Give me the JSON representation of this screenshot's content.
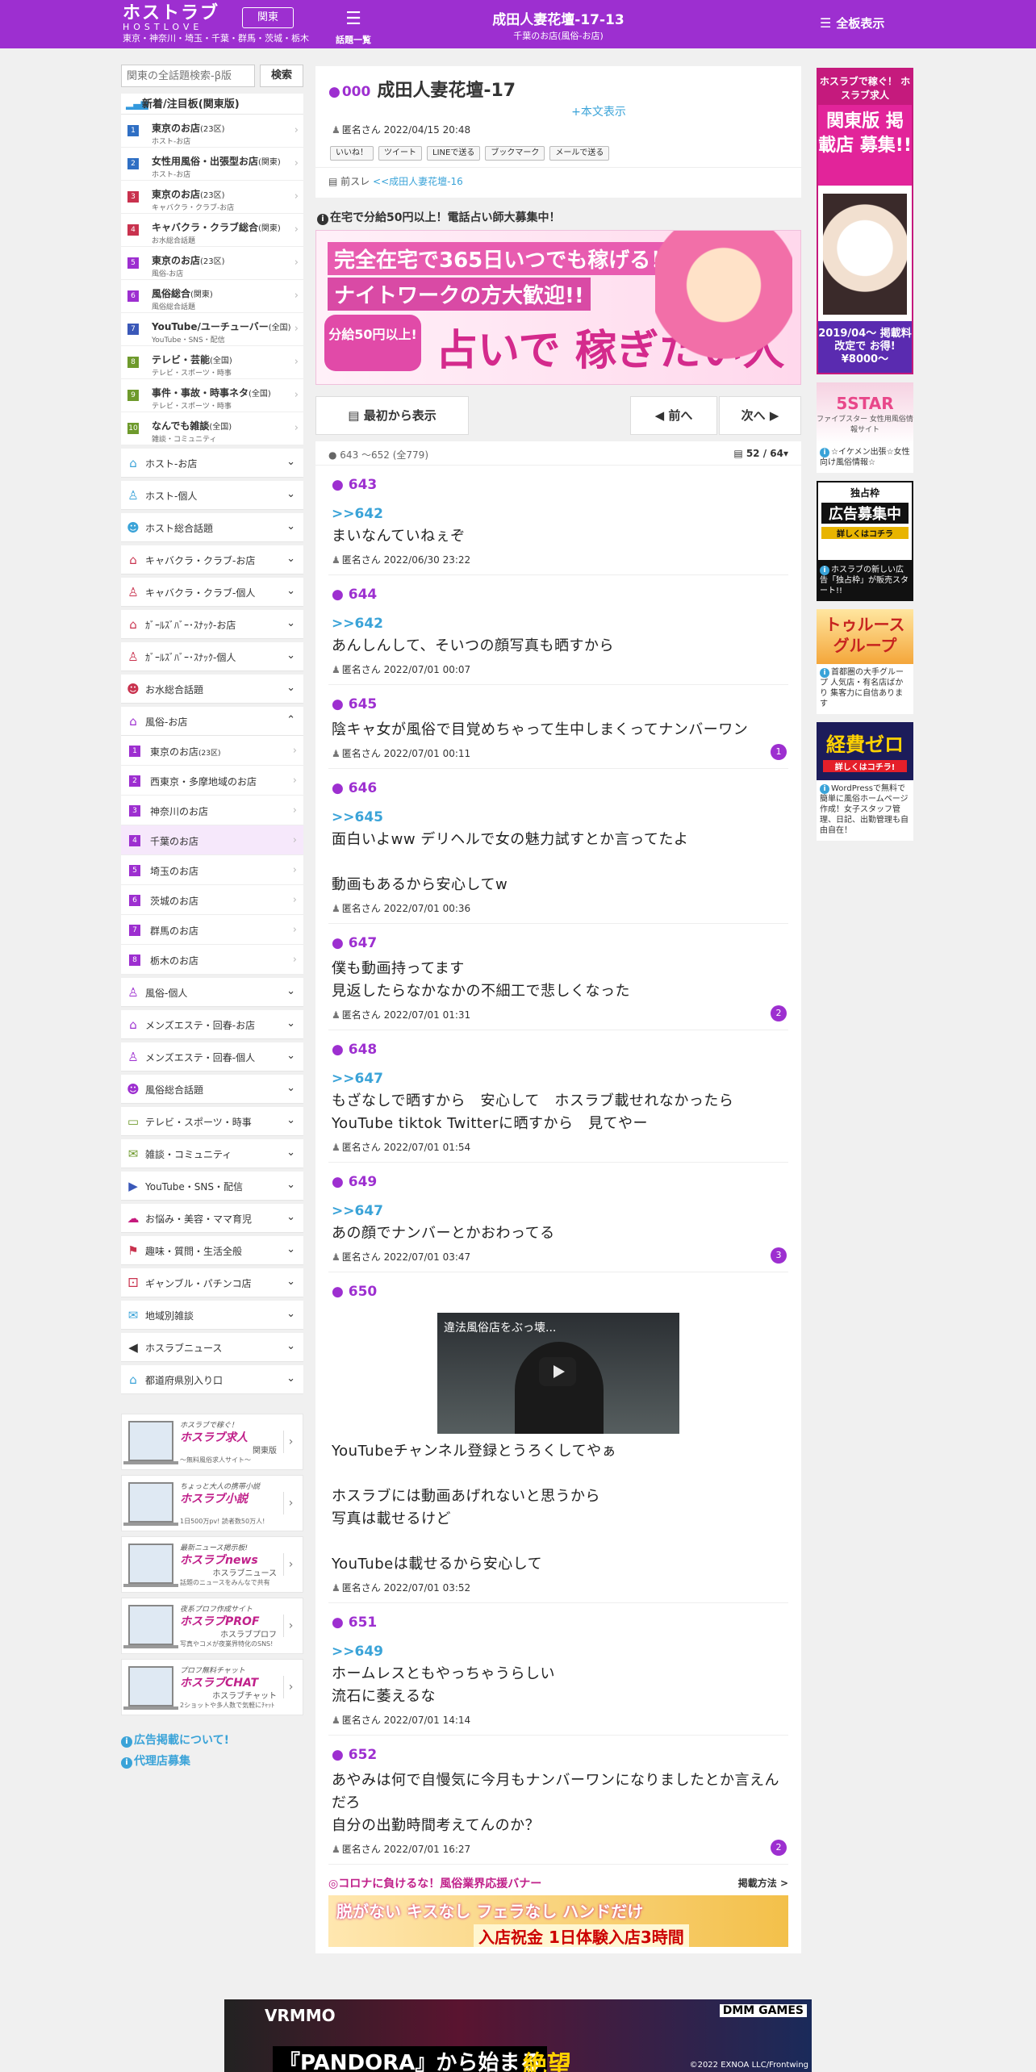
{
  "header": {
    "logo": "ホストラブ",
    "logo_en": "HOSTLOVE",
    "areas": "東京・神奈川・埼玉・千葉・群馬・茨城・栃木",
    "region_button": "関東",
    "topics_label": "話題一覧",
    "thread_title": "成田人妻花壇-17-13",
    "thread_sub": "千葉のお店(風俗-お店)",
    "all_display": "全板表示"
  },
  "search": {
    "placeholder": "関東の全話題検索-β版",
    "button": "検索"
  },
  "ranking": {
    "title": "新着/注目板(関東版)",
    "items": [
      {
        "n": "1",
        "color": "#2f6fc4",
        "title": "東京のお店",
        "tag": "(23区)",
        "sub": "ホスト-お店"
      },
      {
        "n": "2",
        "color": "#2f6fc4",
        "title": "女性用風俗・出張型お店",
        "tag": "(関東)",
        "sub": "ホスト-お店"
      },
      {
        "n": "3",
        "color": "#c9324e",
        "title": "東京のお店",
        "tag": "(23区)",
        "sub": "キャバクラ・クラブ-お店"
      },
      {
        "n": "4",
        "color": "#c9324e",
        "title": "キャバクラ・クラブ総合",
        "tag": "(関東)",
        "sub": "お水総合話題"
      },
      {
        "n": "5",
        "color": "#9d2fd0",
        "title": "東京のお店",
        "tag": "(23区)",
        "sub": "風俗-お店"
      },
      {
        "n": "6",
        "color": "#9d2fd0",
        "title": "風俗総合",
        "tag": "(関東)",
        "sub": "風俗総合話題"
      },
      {
        "n": "7",
        "color": "#3a58b8",
        "title": "YouTube/ユーチューバー",
        "tag": "(全国)",
        "sub": "YouTube・SNS・配信"
      },
      {
        "n": "8",
        "color": "#6e9a2c",
        "title": "テレビ・芸能",
        "tag": "(全国)",
        "sub": "テレビ・スポーツ・時事"
      },
      {
        "n": "9",
        "color": "#6e9a2c",
        "title": "事件・事故・時事ネタ",
        "tag": "(全国)",
        "sub": "テレビ・スポーツ・時事"
      },
      {
        "n": "10",
        "color": "#6e9a2c",
        "title": "なんでも雑談",
        "tag": "(全国)",
        "sub": "雑談・コミュニティ"
      }
    ]
  },
  "categories_a": [
    {
      "icon": "⌂",
      "color": "#3aa3d8",
      "label": "ホスト-お店"
    },
    {
      "icon": "♙",
      "color": "#3aa3d8",
      "label": "ホスト-個人"
    },
    {
      "icon": "☻",
      "color": "#3aa3d8",
      "label": "ホスト総合話題"
    },
    {
      "icon": "⌂",
      "color": "#c9324e",
      "label": "キャバクラ・クラブ-お店"
    },
    {
      "icon": "♙",
      "color": "#c9324e",
      "label": "キャバクラ・クラブ-個人"
    },
    {
      "icon": "⌂",
      "color": "#c9324e",
      "label": "ｶﾞｰﾙｽﾞﾊﾞｰ･ｽﾅｯｸ-お店"
    },
    {
      "icon": "♙",
      "color": "#c9324e",
      "label": "ｶﾞｰﾙｽﾞﾊﾞｰ･ｽﾅｯｸ-個人"
    },
    {
      "icon": "☻",
      "color": "#c9324e",
      "label": "お水総合話題"
    },
    {
      "icon": "⌂",
      "color": "#9d2fd0",
      "label": "風俗-お店"
    }
  ],
  "subs": [
    {
      "n": "1",
      "label": "東京のお店",
      "tag": "(23区)"
    },
    {
      "n": "2",
      "label": "西東京・多摩地域のお店",
      "tag": ""
    },
    {
      "n": "3",
      "label": "神奈川のお店",
      "tag": ""
    },
    {
      "n": "4",
      "label": "千葉のお店",
      "tag": ""
    },
    {
      "n": "5",
      "label": "埼玉のお店",
      "tag": ""
    },
    {
      "n": "6",
      "label": "茨城のお店",
      "tag": ""
    },
    {
      "n": "7",
      "label": "群馬のお店",
      "tag": ""
    },
    {
      "n": "8",
      "label": "栃木のお店",
      "tag": ""
    }
  ],
  "categories_b": [
    {
      "icon": "♙",
      "color": "#9d2fd0",
      "label": "風俗-個人"
    },
    {
      "icon": "⌂",
      "color": "#9d2fd0",
      "label": "メンズエステ・回春-お店"
    },
    {
      "icon": "♙",
      "color": "#9d2fd0",
      "label": "メンズエステ・回春-個人"
    },
    {
      "icon": "☻",
      "color": "#9d2fd0",
      "label": "風俗総合話題"
    },
    {
      "icon": "▭",
      "color": "#6e9a2c",
      "label": "テレビ・スポーツ・時事"
    },
    {
      "icon": "✉",
      "color": "#6e9a2c",
      "label": "雑談・コミュニティ"
    },
    {
      "icon": "▶",
      "color": "#3a58b8",
      "label": "YouTube・SNS・配信"
    },
    {
      "icon": "☁",
      "color": "#c51a7d",
      "label": "お悩み・美容・ママ育児"
    },
    {
      "icon": "⚑",
      "color": "#c9324e",
      "label": "趣味・質問・生活全般"
    },
    {
      "icon": "⚀",
      "color": "#c9324e",
      "label": "ギャンブル・パチンコ店"
    },
    {
      "icon": "✉",
      "color": "#3aa3d8",
      "label": "地域別雑談"
    },
    {
      "icon": "◀",
      "color": "#333333",
      "label": "ホスラブニュース"
    },
    {
      "icon": "⌂",
      "color": "#3aa3d8",
      "label": "都道府県別入り口"
    }
  ],
  "promos": [
    {
      "tag": "ホスラブで稼ぐ！",
      "name": "ホスラブ求人",
      "d1": "関東版",
      "d2": "〜無料風俗求人サイト〜"
    },
    {
      "tag": "ちょっと大人の携帯小説",
      "name": "ホスラブ小説",
      "d1": "",
      "d2": "1日500万pv! 読者数50万人!"
    },
    {
      "tag": "最新ニュース掲示板!",
      "name": "ホスラブnews",
      "d1": "ホスラブニュース",
      "d2": "話題のニュースをみんなで共有"
    },
    {
      "tag": "夜系プロフ作成サイト",
      "name": "ホスラブPROF",
      "d1": "ホスラブプロフ",
      "d2": "写真やコメが夜業界特化のSNS!"
    },
    {
      "tag": "プロフ無料チャット",
      "name": "ホスラブCHAT",
      "d1": "ホスラブチャット",
      "d2": "2ショットや多人数で気軽にﾁｬｯﾄ"
    }
  ],
  "left_links": {
    "ad": "広告掲載について!",
    "agency": "代理店募集"
  },
  "thread": {
    "no": "000",
    "title": "成田人妻花壇-17",
    "show_body": "+本文表示",
    "author": "匿名さん",
    "date": "2022/04/15 20:48",
    "shares": [
      "いいね！",
      "ツイート",
      "LINEで送る",
      "ブックマーク",
      "メールで送る"
    ],
    "prev_label": "前スレ",
    "prev_link": "<<成田人妻花壇-16"
  },
  "ad_heading": "在宅で分給50円以上！電話占い師大募集中！",
  "banner": {
    "line1": "完全在宅で365日いつでも稼げる！",
    "line2": "ナイトワークの方大歓迎!!",
    "pill": "分給50円以上!",
    "big": "占いで 稼ぎたい人 大募集！"
  },
  "nav": {
    "first": "最初から表示",
    "prev": "前へ",
    "next": "次へ"
  },
  "posts_header": {
    "range": "643 ～652 (全779)",
    "page": "52 / 64"
  },
  "posts": [
    {
      "no": "643",
      "anchor": ">>642",
      "text": "まいなんていねぇぞ",
      "author": "匿名さん",
      "date": "2022/06/30 23:22",
      "count": ""
    },
    {
      "no": "644",
      "anchor": ">>642",
      "text": "あんしんして、そいつの顔写真も晒すから",
      "author": "匿名さん",
      "date": "2022/07/01 00:07",
      "count": ""
    },
    {
      "no": "645",
      "anchor": "",
      "text": "陰キャ女が風俗で目覚めちゃって生中しまくってナンバーワン",
      "author": "匿名さん",
      "date": "2022/07/01 00:11",
      "count": "1"
    },
    {
      "no": "646",
      "anchor": ">>645",
      "text": "面白いよww デリヘルで女の魅力試すとか言ってたよ\n\n動画もあるから安心してw",
      "author": "匿名さん",
      "date": "2022/07/01 00:36",
      "count": ""
    },
    {
      "no": "647",
      "anchor": "",
      "text": "僕も動画持ってます\n見返したらなかなかの不細工で悲しくなった",
      "author": "匿名さん",
      "date": "2022/07/01 01:31",
      "count": "2"
    },
    {
      "no": "648",
      "anchor": ">>647",
      "text": "もざなしで晒すから　安心して　ホスラブ載せれなかったらYouTube tiktok Twitterに晒すから　見てやー",
      "author": "匿名さん",
      "date": "2022/07/01 01:54",
      "count": ""
    },
    {
      "no": "649",
      "anchor": ">>647",
      "text": "あの顔でナンバーとかおわってる",
      "author": "匿名さん",
      "date": "2022/07/01 03:47",
      "count": "3"
    },
    {
      "no": "650",
      "anchor": "",
      "video": "違法風俗店をぶっ壊...",
      "text": "YouTubeチャンネル登録とうろくしてやぁ\n\nホスラブには動画あげれないと思うから\n写真は載せるけど\n\nYouTubeは載せるから安心して",
      "author": "匿名さん",
      "date": "2022/07/01 03:52",
      "count": ""
    },
    {
      "no": "651",
      "anchor": ">>649",
      "text": "ホームレスともやっちゃうらしい\n流石に萎えるな",
      "author": "匿名さん",
      "date": "2022/07/01 14:14",
      "count": ""
    },
    {
      "no": "652",
      "anchor": "",
      "text": "あやみは何で自慢気に今月もナンバーワンになりましたとか言えんだろ\n自分の出勤時間考えてんのか？",
      "author": "匿名さん",
      "date": "2022/07/01 16:27",
      "count": "2"
    }
  ],
  "corona": {
    "title": "◎コロナに負けるな！風俗業界応援バナー",
    "how": "掲載方法 >",
    "ad1": "脱がない キスなし フェラなし ハンドだけ",
    "ad2": "入店祝金 1日体験入店3時間"
  },
  "right_ads": [
    {
      "id": "r1",
      "top": "ホスラブで稼ぐ！ ホスラブ求人",
      "mid": "関東版 掲載店 募集!!",
      "bot": "2019/04〜 掲載料改定で お得!¥8000〜",
      "cap": ""
    },
    {
      "id": "r2",
      "top": "5STAR",
      "mid": "ファイブスター 女性用風俗情報サイト",
      "bot": "",
      "cap": "☆イケメン出張☆女性向け風俗情報☆"
    },
    {
      "id": "r3",
      "top": "独占枠",
      "mid": "広告募集中",
      "bot": "詳しくはコチラ",
      "cap": "ホスラブの新しい広告「独占枠」が販売スタート!!"
    },
    {
      "id": "r4",
      "top": "トゥルース グループ",
      "mid": "",
      "bot": "",
      "cap": "首都圏の大手グループ 人気店・有名店ばかり 集客力に自信あります"
    },
    {
      "id": "r5",
      "top": "経費ゼロ",
      "mid": "詳しくはコチラ!",
      "bot": "",
      "cap": "WordPressで無料で簡単に風俗ホームページ作成！女子スタッフ管理、日記、出勤管理も自由自在！"
    }
  ],
  "bottom_ad": {
    "brand": "VRMMO",
    "title": "『PANDORA』から始まる",
    "big": "絶望",
    "logo": "DMM GAMES",
    "copy": "©2022 EXNOA LLC/Frontwing"
  }
}
